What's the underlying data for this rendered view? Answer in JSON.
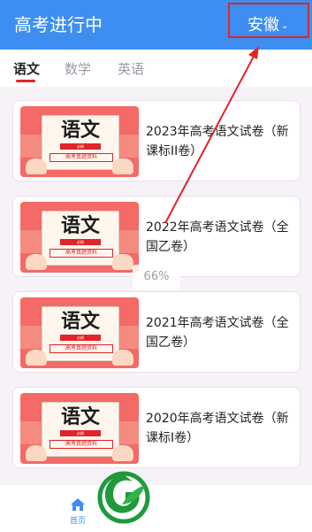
{
  "header": {
    "title": "高考进行中",
    "region": "安徽"
  },
  "tabs": [
    {
      "label": "语文",
      "active": true
    },
    {
      "label": "数学",
      "active": false
    },
    {
      "label": "英语",
      "active": false
    }
  ],
  "thumbnail": {
    "big_text": "语文",
    "ribbon": "必刷",
    "sub": "高考真题资料"
  },
  "papers": [
    {
      "title": "2023年高考语文试卷（新课标II卷）"
    },
    {
      "title": "2022年高考语文试卷（全国乙卷）"
    },
    {
      "title": "2021年高考语文试卷（全国乙卷）"
    },
    {
      "title": "2020年高考语文试卷（新课标I卷）"
    }
  ],
  "zoom": "66%",
  "bottom_nav": {
    "home_label": "首页"
  },
  "colors": {
    "header": "#3d8ef0",
    "accent": "#e0242a",
    "logo_green": "#1f9a3a"
  },
  "icons": [
    "chevron-down-icon",
    "home-icon",
    "leaf-logo"
  ]
}
